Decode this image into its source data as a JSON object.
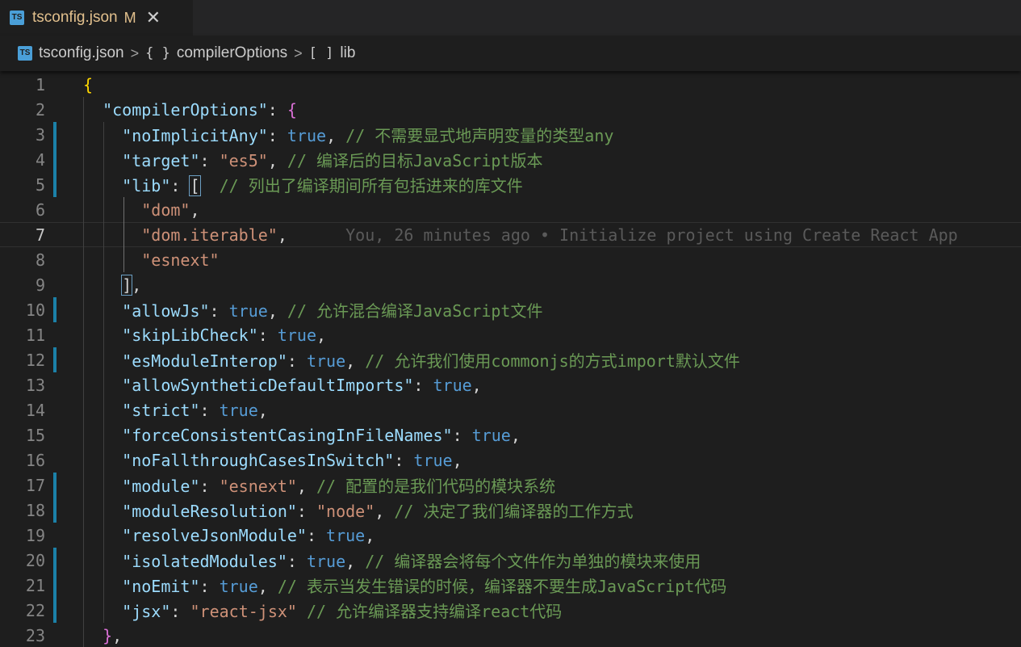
{
  "tab": {
    "title": "tsconfig.json",
    "status": "M",
    "close": "✕",
    "file_icon": "TS"
  },
  "breadcrumb": [
    {
      "glyph": "TS",
      "label": "tsconfig.json"
    },
    {
      "glyph": "{ }",
      "label": "compilerOptions"
    },
    {
      "glyph": "[ ]",
      "label": "lib"
    }
  ],
  "blame": "You, 26 minutes ago • Initialize project using Create React App",
  "current_line": 7,
  "lines": [
    {
      "n": "1",
      "tokens": [
        {
          "t": "{",
          "c": "brace1"
        }
      ]
    },
    {
      "n": "2",
      "tokens": [
        {
          "t": "  "
        },
        {
          "t": "\"compilerOptions\"",
          "c": "k"
        },
        {
          "t": ": "
        },
        {
          "t": "{",
          "c": "brace2"
        }
      ]
    },
    {
      "n": "3",
      "mod": true,
      "tokens": [
        {
          "t": "    "
        },
        {
          "t": "\"noImplicitAny\"",
          "c": "k"
        },
        {
          "t": ": "
        },
        {
          "t": "true",
          "c": "b"
        },
        {
          "t": ", "
        },
        {
          "t": "// 不需要显式地声明变量的类型any",
          "c": "c"
        }
      ]
    },
    {
      "n": "4",
      "mod": true,
      "tokens": [
        {
          "t": "    "
        },
        {
          "t": "\"target\"",
          "c": "k"
        },
        {
          "t": ": "
        },
        {
          "t": "\"es5\"",
          "c": "s"
        },
        {
          "t": ", "
        },
        {
          "t": "// 编译后的目标JavaScript版本",
          "c": "c"
        }
      ]
    },
    {
      "n": "5",
      "mod": true,
      "tokens": [
        {
          "t": "    "
        },
        {
          "t": "\"lib\"",
          "c": "k"
        },
        {
          "t": ": "
        },
        {
          "t": "[",
          "c": "brk"
        },
        {
          "t": "  "
        },
        {
          "t": "// 列出了编译期间所有包括进来的库文件",
          "c": "c"
        }
      ]
    },
    {
      "n": "6",
      "tokens": [
        {
          "t": "      "
        },
        {
          "t": "\"dom\"",
          "c": "s"
        },
        {
          "t": ","
        }
      ]
    },
    {
      "n": "7",
      "tokens": [
        {
          "t": "      "
        },
        {
          "t": "\"dom.iterable\"",
          "c": "s"
        },
        {
          "t": ","
        }
      ]
    },
    {
      "n": "8",
      "tokens": [
        {
          "t": "      "
        },
        {
          "t": "\"esnext\"",
          "c": "s"
        }
      ]
    },
    {
      "n": "9",
      "tokens": [
        {
          "t": "    "
        },
        {
          "t": "]",
          "c": "brk"
        },
        {
          "t": ","
        }
      ]
    },
    {
      "n": "10",
      "mod": true,
      "tokens": [
        {
          "t": "    "
        },
        {
          "t": "\"allowJs\"",
          "c": "k"
        },
        {
          "t": ": "
        },
        {
          "t": "true",
          "c": "b"
        },
        {
          "t": ", "
        },
        {
          "t": "// 允许混合编译JavaScript文件",
          "c": "c"
        }
      ]
    },
    {
      "n": "11",
      "tokens": [
        {
          "t": "    "
        },
        {
          "t": "\"skipLibCheck\"",
          "c": "k"
        },
        {
          "t": ": "
        },
        {
          "t": "true",
          "c": "b"
        },
        {
          "t": ","
        }
      ]
    },
    {
      "n": "12",
      "mod": true,
      "tokens": [
        {
          "t": "    "
        },
        {
          "t": "\"esModuleInterop\"",
          "c": "k"
        },
        {
          "t": ": "
        },
        {
          "t": "true",
          "c": "b"
        },
        {
          "t": ", "
        },
        {
          "t": "// 允许我们使用commonjs的方式import默认文件",
          "c": "c"
        }
      ]
    },
    {
      "n": "13",
      "tokens": [
        {
          "t": "    "
        },
        {
          "t": "\"allowSyntheticDefaultImports\"",
          "c": "k"
        },
        {
          "t": ": "
        },
        {
          "t": "true",
          "c": "b"
        },
        {
          "t": ","
        }
      ]
    },
    {
      "n": "14",
      "tokens": [
        {
          "t": "    "
        },
        {
          "t": "\"strict\"",
          "c": "k"
        },
        {
          "t": ": "
        },
        {
          "t": "true",
          "c": "b"
        },
        {
          "t": ","
        }
      ]
    },
    {
      "n": "15",
      "tokens": [
        {
          "t": "    "
        },
        {
          "t": "\"forceConsistentCasingInFileNames\"",
          "c": "k"
        },
        {
          "t": ": "
        },
        {
          "t": "true",
          "c": "b"
        },
        {
          "t": ","
        }
      ]
    },
    {
      "n": "16",
      "tokens": [
        {
          "t": "    "
        },
        {
          "t": "\"noFallthroughCasesInSwitch\"",
          "c": "k"
        },
        {
          "t": ": "
        },
        {
          "t": "true",
          "c": "b"
        },
        {
          "t": ","
        }
      ]
    },
    {
      "n": "17",
      "mod": true,
      "tokens": [
        {
          "t": "    "
        },
        {
          "t": "\"module\"",
          "c": "k"
        },
        {
          "t": ": "
        },
        {
          "t": "\"esnext\"",
          "c": "s"
        },
        {
          "t": ", "
        },
        {
          "t": "// 配置的是我们代码的模块系统",
          "c": "c"
        }
      ]
    },
    {
      "n": "18",
      "mod": true,
      "tokens": [
        {
          "t": "    "
        },
        {
          "t": "\"moduleResolution\"",
          "c": "k"
        },
        {
          "t": ": "
        },
        {
          "t": "\"node\"",
          "c": "s"
        },
        {
          "t": ", "
        },
        {
          "t": "// 决定了我们编译器的工作方式",
          "c": "c"
        }
      ]
    },
    {
      "n": "19",
      "tokens": [
        {
          "t": "    "
        },
        {
          "t": "\"resolveJsonModule\"",
          "c": "k"
        },
        {
          "t": ": "
        },
        {
          "t": "true",
          "c": "b"
        },
        {
          "t": ","
        }
      ]
    },
    {
      "n": "20",
      "mod": true,
      "tokens": [
        {
          "t": "    "
        },
        {
          "t": "\"isolatedModules\"",
          "c": "k"
        },
        {
          "t": ": "
        },
        {
          "t": "true",
          "c": "b"
        },
        {
          "t": ", "
        },
        {
          "t": "// 编译器会将每个文件作为单独的模块来使用",
          "c": "c"
        }
      ]
    },
    {
      "n": "21",
      "mod": true,
      "tokens": [
        {
          "t": "    "
        },
        {
          "t": "\"noEmit\"",
          "c": "k"
        },
        {
          "t": ": "
        },
        {
          "t": "true",
          "c": "b"
        },
        {
          "t": ", "
        },
        {
          "t": "// 表示当发生错误的时候，编译器不要生成JavaScript代码",
          "c": "c"
        }
      ]
    },
    {
      "n": "22",
      "mod": true,
      "tokens": [
        {
          "t": "    "
        },
        {
          "t": "\"jsx\"",
          "c": "k"
        },
        {
          "t": ": "
        },
        {
          "t": "\"react-jsx\"",
          "c": "s"
        },
        {
          "t": " "
        },
        {
          "t": "// 允许编译器支持编译react代码",
          "c": "c"
        }
      ]
    },
    {
      "n": "23",
      "tokens": [
        {
          "t": "  "
        },
        {
          "t": "}",
          "c": "brace2"
        },
        {
          "t": ","
        }
      ]
    }
  ]
}
